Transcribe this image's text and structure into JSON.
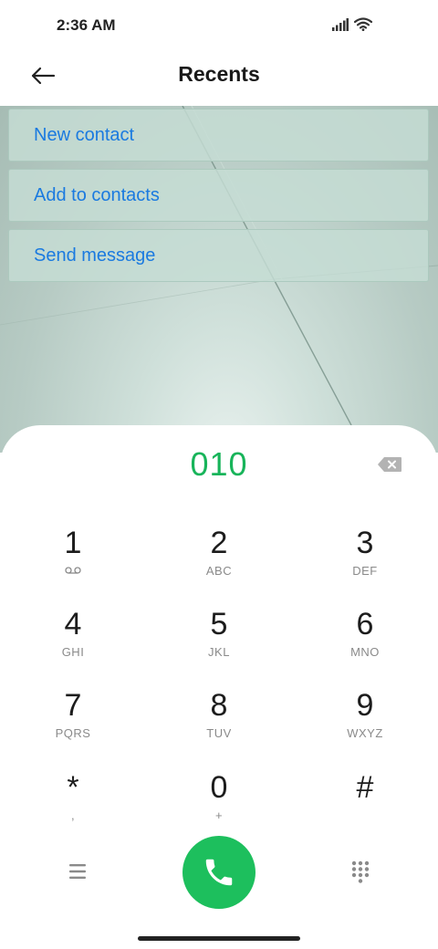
{
  "status_bar": {
    "time": "2:36 AM"
  },
  "header": {
    "title": "Recents"
  },
  "actions": [
    {
      "label": "New contact"
    },
    {
      "label": "Add to contacts"
    },
    {
      "label": "Send message"
    }
  ],
  "dialer": {
    "number": "010",
    "keys": [
      {
        "digit": "1",
        "letters": ""
      },
      {
        "digit": "2",
        "letters": "ABC"
      },
      {
        "digit": "3",
        "letters": "DEF"
      },
      {
        "digit": "4",
        "letters": "GHI"
      },
      {
        "digit": "5",
        "letters": "JKL"
      },
      {
        "digit": "6",
        "letters": "MNO"
      },
      {
        "digit": "7",
        "letters": "PQRS"
      },
      {
        "digit": "8",
        "letters": "TUV"
      },
      {
        "digit": "9",
        "letters": "WXYZ"
      },
      {
        "digit": "*",
        "letters": ","
      },
      {
        "digit": "0",
        "letters": "+"
      },
      {
        "digit": "#",
        "letters": ""
      }
    ]
  },
  "icons": {
    "back": "arrow-left-icon",
    "signal": "signal-icon",
    "wifi": "wifi-icon",
    "voicemail": "voicemail-icon",
    "backspace": "backspace-icon",
    "menu": "menu-icon",
    "call": "phone-icon",
    "keypad": "keypad-icon"
  },
  "colors": {
    "accent_link": "#1a7ae0",
    "number_green": "#18b45a",
    "call_button": "#1dbf5d"
  }
}
